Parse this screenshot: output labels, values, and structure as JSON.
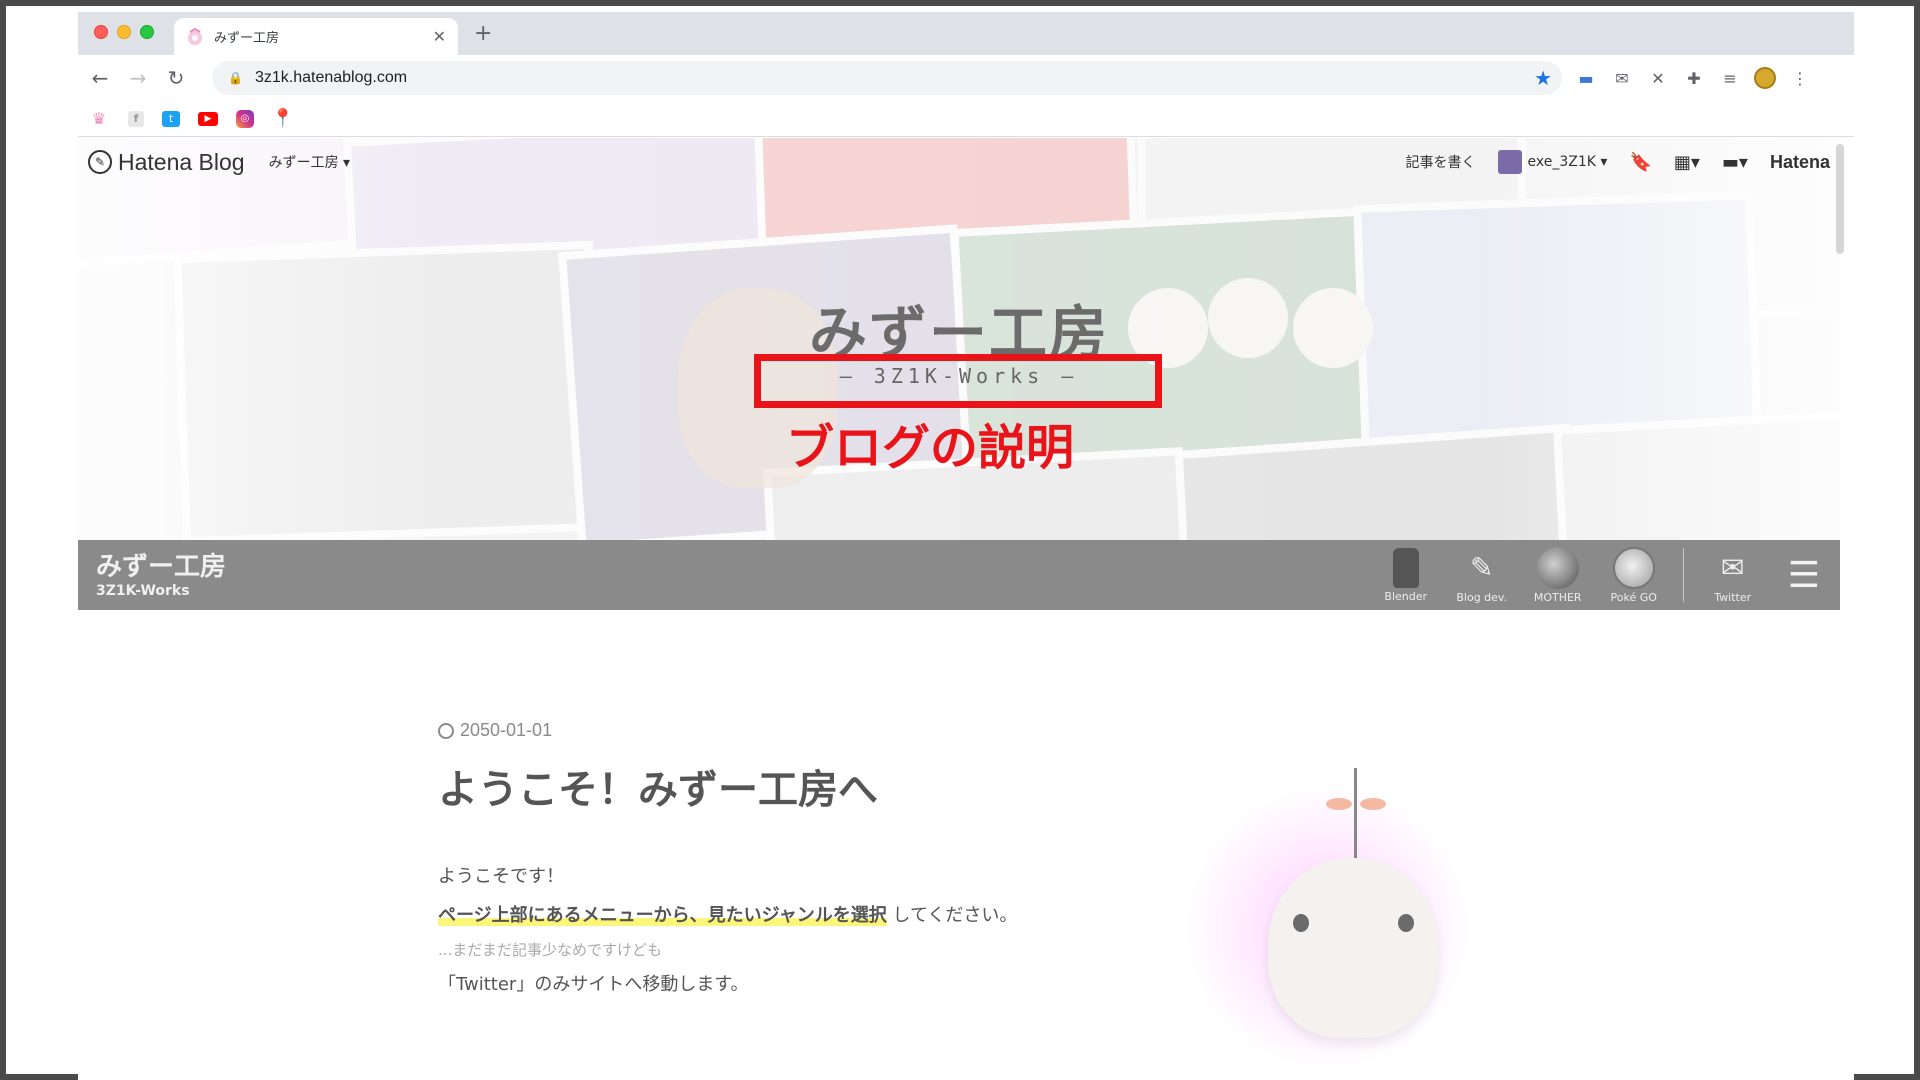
{
  "browser": {
    "tab_title": "みずー工房",
    "new_tab_label": "+",
    "close_label": "✕",
    "url": "3z1k.hatenablog.com",
    "bookmarks": [
      {
        "name": "hatena-favicon",
        "glyph": "♛"
      },
      {
        "name": "facebook",
        "glyph": "f"
      },
      {
        "name": "twitter",
        "glyph": "t"
      },
      {
        "name": "youtube",
        "glyph": "▶"
      },
      {
        "name": "instagram",
        "glyph": "◎"
      },
      {
        "name": "google-maps",
        "glyph": "📍"
      }
    ]
  },
  "hatena_bar": {
    "logo": "Hatena Blog",
    "blog_select": "みずー工房 ▾",
    "write_entry": "記事を書く",
    "username": "exe_3Z1K ▾",
    "hatena": "Hatena"
  },
  "blog": {
    "title": "みずー工房",
    "description": "— 3Z1K-Works —",
    "annotation": "ブログの説明"
  },
  "nav_band": {
    "title": "みずー工房",
    "subtitle": "3Z1K-Works",
    "menu": [
      {
        "label": "Blender",
        "icon": "lantern-icon"
      },
      {
        "label": "Blog dev.",
        "icon": "tools-icon"
      },
      {
        "label": "MOTHER",
        "icon": "earth-icon"
      },
      {
        "label": "Poké GO",
        "icon": "pokecoin-icon"
      },
      {
        "label": "Twitter",
        "icon": "bird-icon"
      }
    ]
  },
  "article": {
    "date": "2050-01-01",
    "title": "ようこそ！みずー工房へ",
    "line1": "ようこそです！",
    "line2_highlight": "ページ上部にあるメニューから、見たいジャンルを選択",
    "line2_rest": "してください。",
    "line3": "...まだまだ記事少なめですけども",
    "line4": "「Twitter」のみサイトへ移動します。"
  },
  "colors": {
    "annotation_red": "#e8141a",
    "band_gray": "#8a8a8a",
    "highlight_yellow": "#fbf57a"
  }
}
